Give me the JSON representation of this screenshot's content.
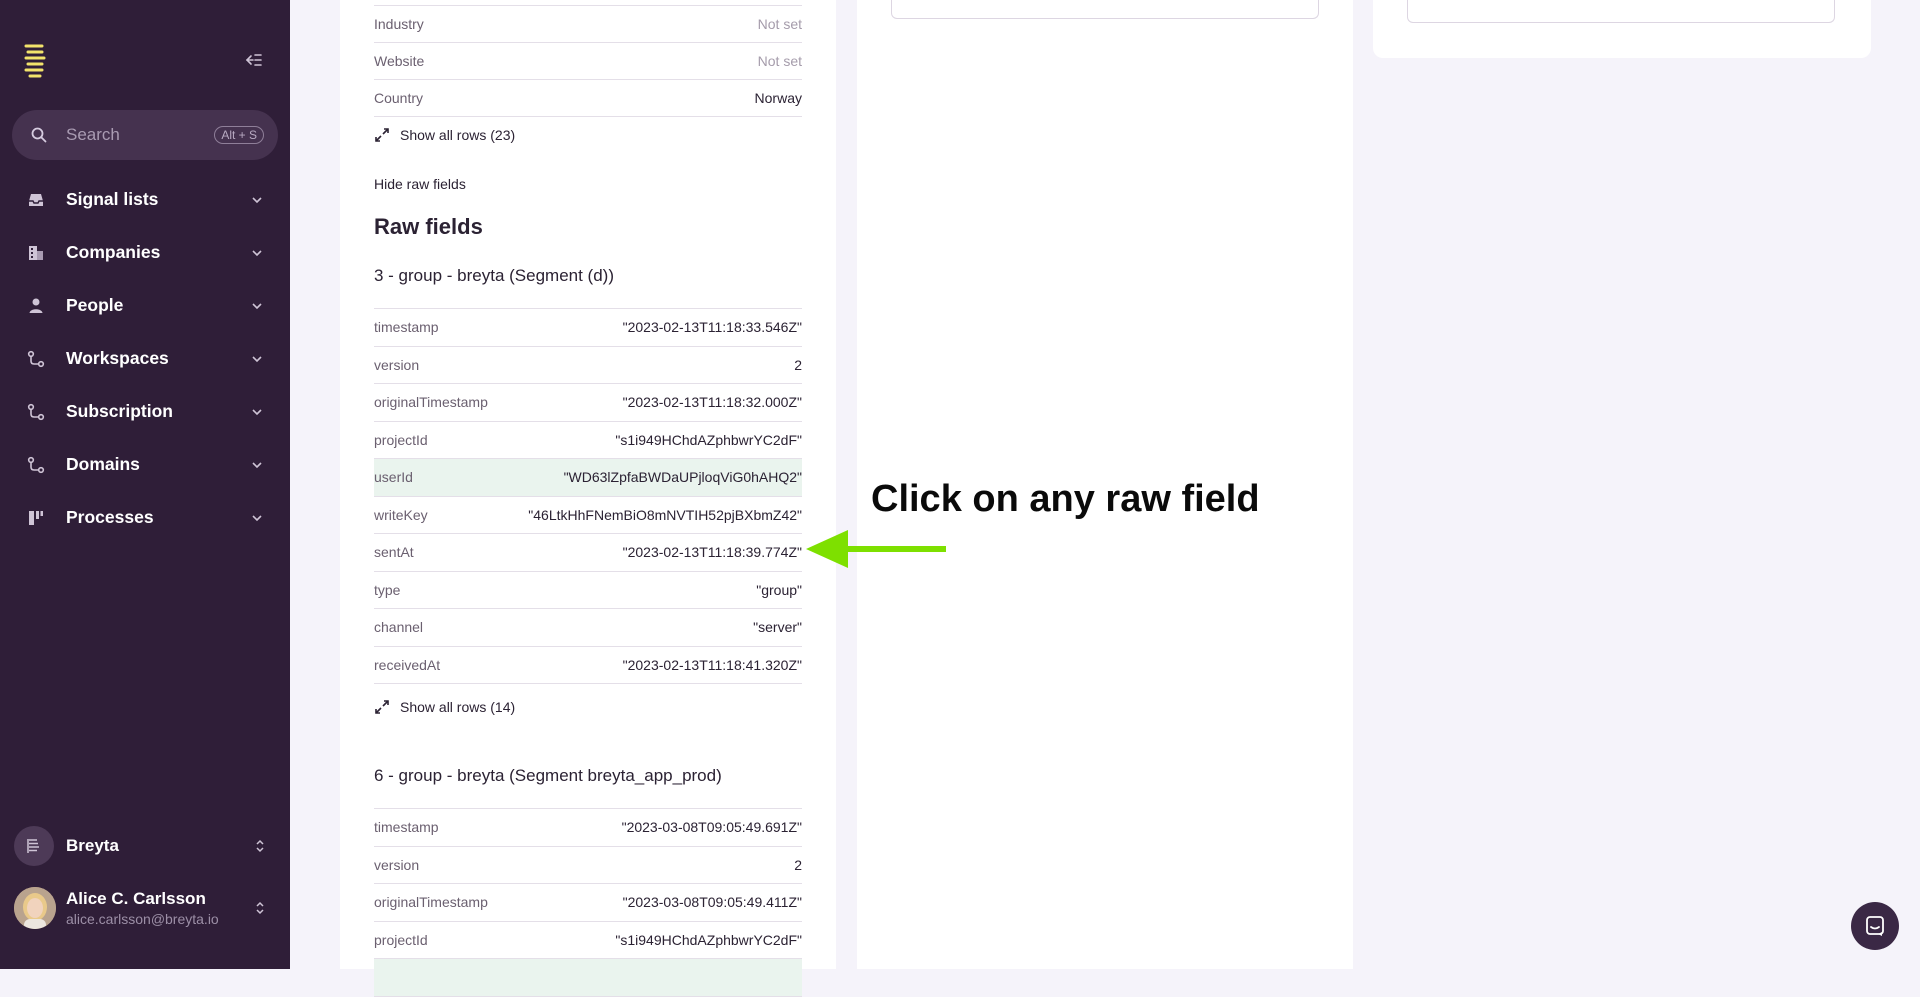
{
  "sidebar": {
    "search": {
      "placeholder": "Search",
      "shortcut": "Alt + S"
    },
    "nav": [
      {
        "label": "Signal lists",
        "icon": "inbox-icon"
      },
      {
        "label": "Companies",
        "icon": "building-icon"
      },
      {
        "label": "People",
        "icon": "person-icon"
      },
      {
        "label": "Workspaces",
        "icon": "workflow-icon"
      },
      {
        "label": "Subscription",
        "icon": "workflow-icon"
      },
      {
        "label": "Domains",
        "icon": "workflow-icon"
      },
      {
        "label": "Processes",
        "icon": "kanban-icon"
      }
    ],
    "workspace": {
      "name": "Breyta"
    },
    "user": {
      "name": "Alice C. Carlsson",
      "email": "alice.carlsson@breyta.io"
    }
  },
  "main": {
    "top_rows": [
      {
        "key": "Industry",
        "value": "Not set",
        "muted": true
      },
      {
        "key": "Website",
        "value": "Not set",
        "muted": true
      },
      {
        "key": "Country",
        "value": "Norway",
        "muted": false
      }
    ],
    "show_all_top": "Show all rows (23)",
    "hide_raw": "Hide raw fields",
    "raw_title": "Raw fields",
    "group1": {
      "title": "3 - group - breyta (Segment (d))",
      "rows": [
        {
          "key": "timestamp",
          "value": "\"2023-02-13T11:18:33.546Z\""
        },
        {
          "key": "version",
          "value": "2"
        },
        {
          "key": "originalTimestamp",
          "value": "\"2023-02-13T11:18:32.000Z\""
        },
        {
          "key": "projectId",
          "value": "\"s1i949HChdAZphbwrYC2dF\""
        },
        {
          "key": "userId",
          "value": "\"WD63lZpfaBWDaUPjloqViG0hAHQ2\""
        },
        {
          "key": "writeKey",
          "value": "\"46LtkHhFNemBiO8mNVTIH52pjBXbmZ42\""
        },
        {
          "key": "sentAt",
          "value": "\"2023-02-13T11:18:39.774Z\""
        },
        {
          "key": "type",
          "value": "\"group\""
        },
        {
          "key": "channel",
          "value": "\"server\""
        },
        {
          "key": "receivedAt",
          "value": "\"2023-02-13T11:18:41.320Z\""
        }
      ],
      "show_all": "Show all rows (14)"
    },
    "group2": {
      "title": "6 - group - breyta (Segment breyta_app_prod)",
      "rows": [
        {
          "key": "timestamp",
          "value": "\"2023-03-08T09:05:49.691Z\""
        },
        {
          "key": "version",
          "value": "2"
        },
        {
          "key": "originalTimestamp",
          "value": "\"2023-03-08T09:05:49.411Z\""
        },
        {
          "key": "projectId",
          "value": "\"s1i949HChdAZphbwrYC2dF\""
        }
      ]
    }
  },
  "annotation": {
    "text": "Click on any raw field",
    "arrow_color": "#7ee000"
  },
  "colors": {
    "sidebar": "#2f1e38",
    "accent_yellow": "#f2e36b",
    "highlight_row": "#eaf4ee"
  }
}
